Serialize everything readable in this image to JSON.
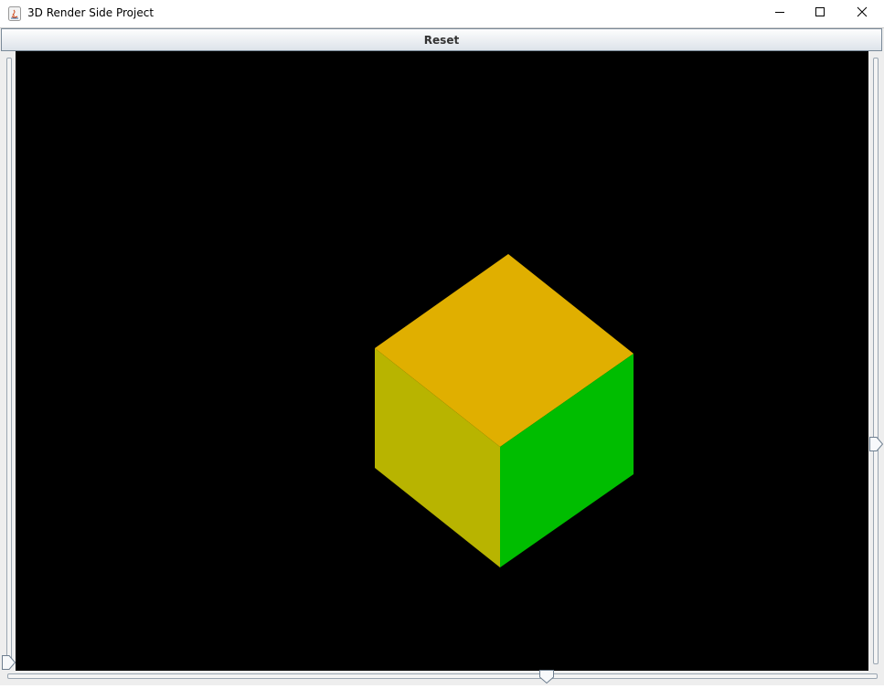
{
  "window": {
    "title": "3D Render Side Project",
    "icon": "java-icon",
    "controls": [
      "minimize-icon",
      "maximize-icon",
      "close-icon"
    ]
  },
  "toolbar": {
    "reset_label": "Reset"
  },
  "viewport": {
    "background": "#000000",
    "object": "cube",
    "face_colors": {
      "top": "#e0af00",
      "left": "#b8b400",
      "right": "#00bd00"
    }
  },
  "sliders": {
    "left_vertical": {
      "orientation": "vertical",
      "value": 0.0
    },
    "right_vertical": {
      "orientation": "vertical",
      "value": 0.35
    },
    "bottom_horizontal": {
      "orientation": "horizontal",
      "value": 0.62
    }
  }
}
